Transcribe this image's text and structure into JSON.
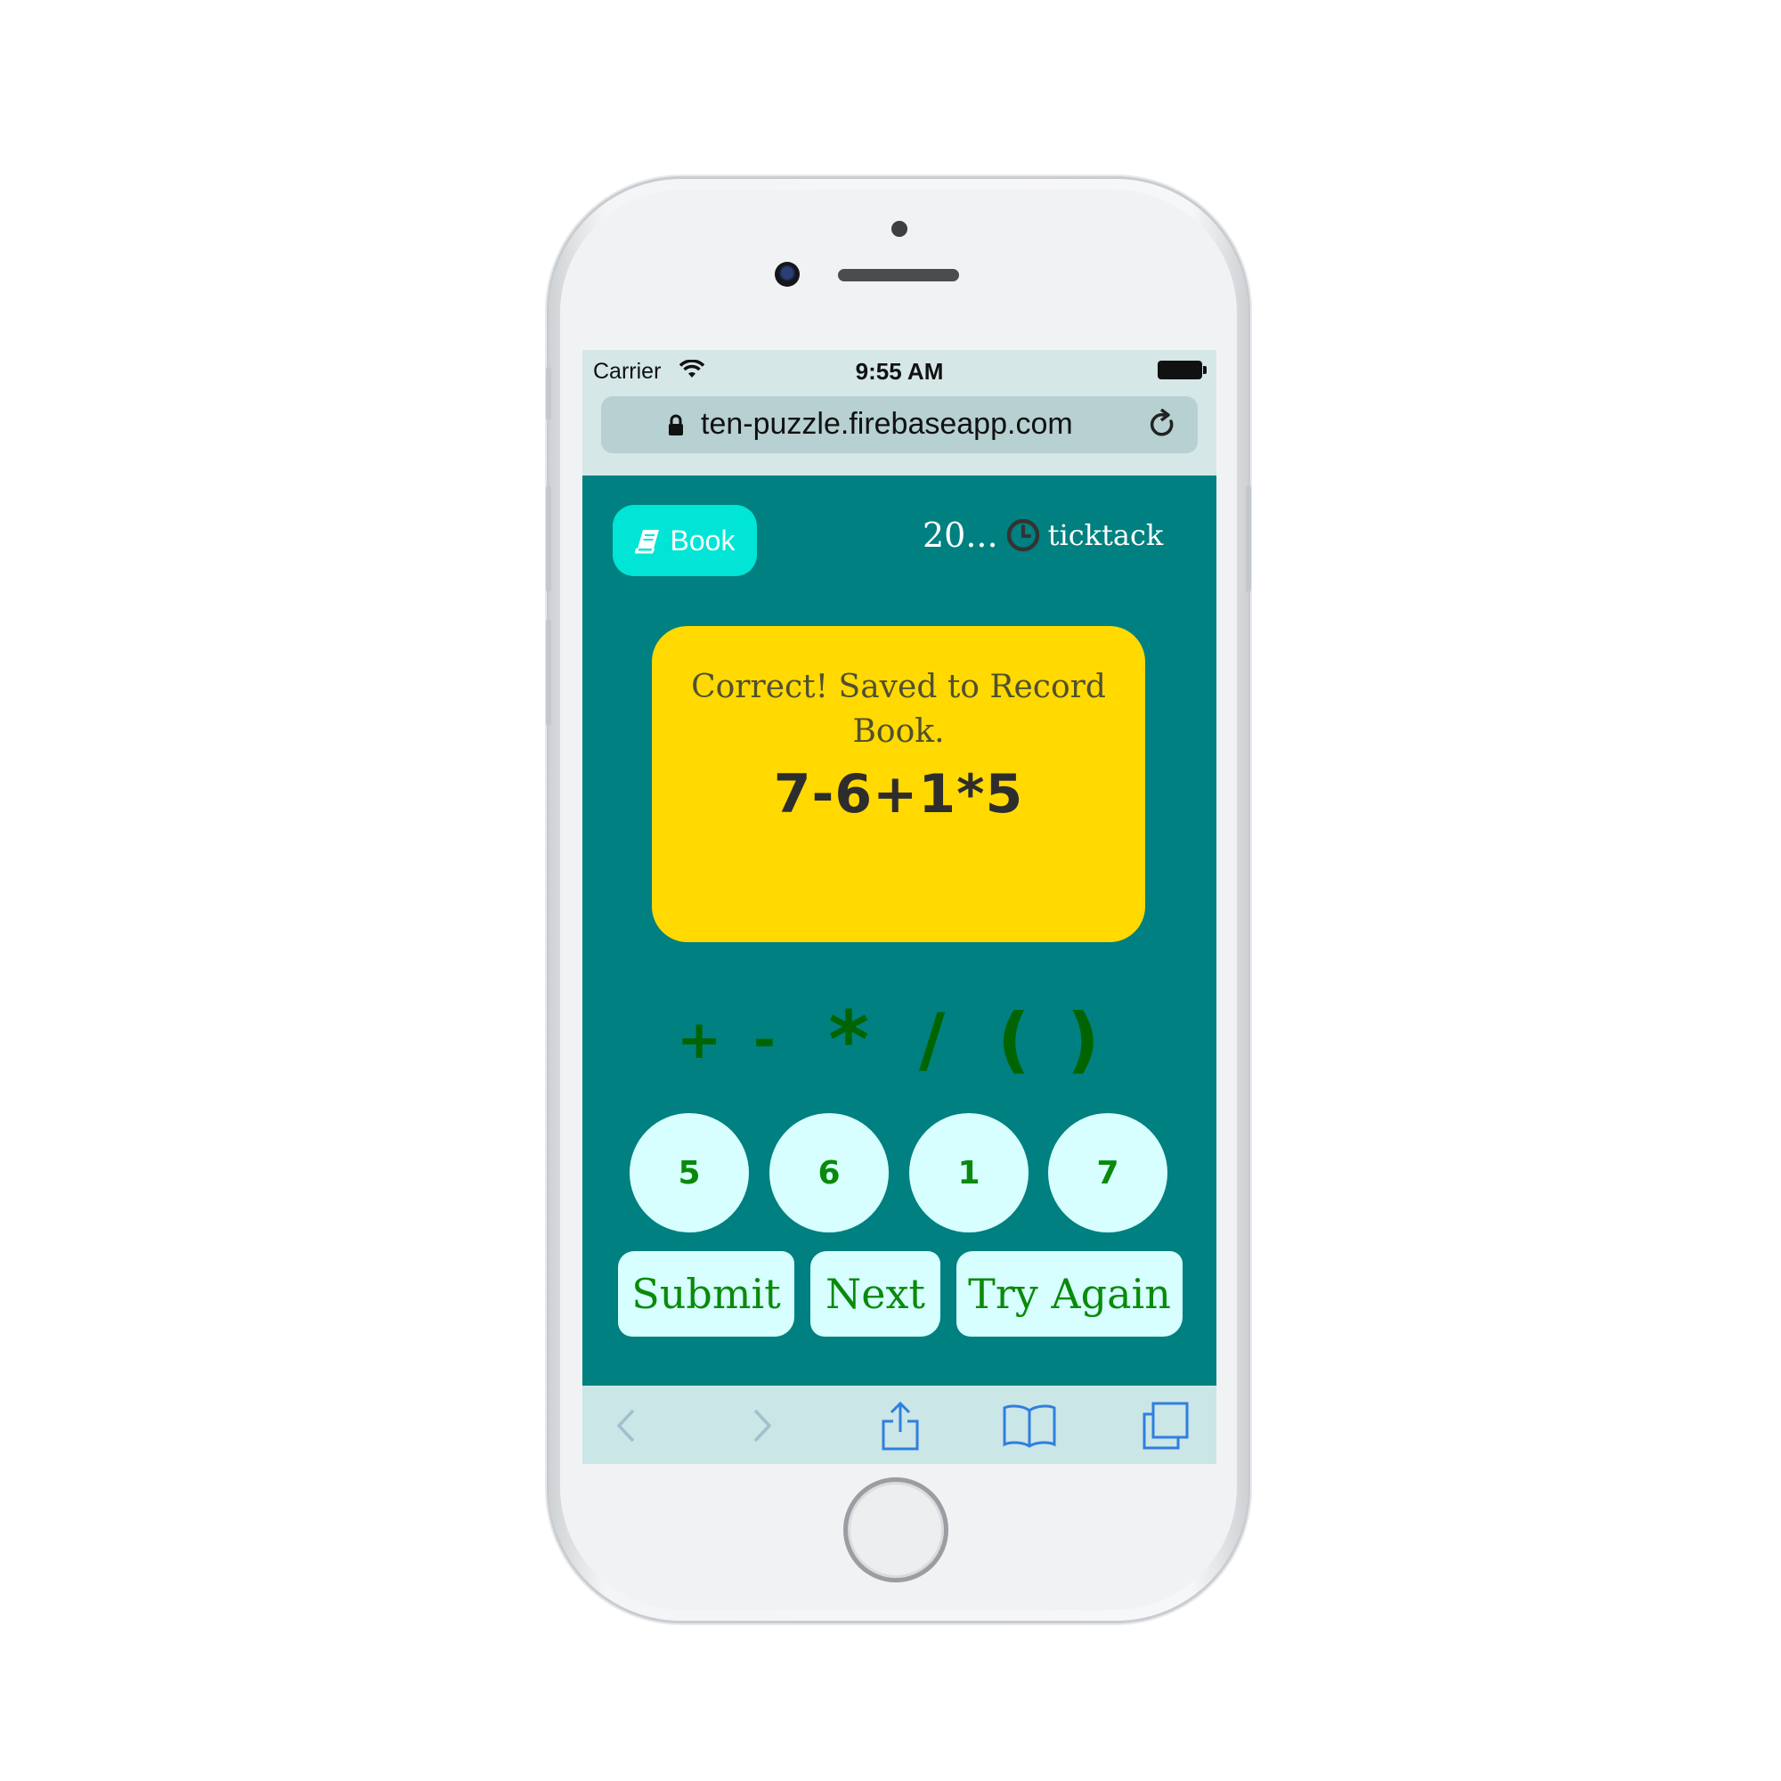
{
  "status_bar": {
    "carrier": "Carrier",
    "time": "9:55 AM"
  },
  "browser": {
    "url": "ten-puzzle.firebaseapp.com"
  },
  "header": {
    "book_label": "Book",
    "timer_count": "20...",
    "timer_label": "ticktack"
  },
  "message": {
    "text": "Correct! Saved to Record Book.",
    "expression": "7-6+1*5"
  },
  "operators": [
    "+",
    "-",
    "*",
    "/",
    "(",
    ")"
  ],
  "numbers": [
    "5",
    "6",
    "1",
    "7"
  ],
  "actions": {
    "submit": "Submit",
    "next": "Next",
    "try_again": "Try Again"
  },
  "colors": {
    "background": "#008080",
    "card": "#ffd900",
    "button": "#d7ffff",
    "book_button": "#00e5d5",
    "operator": "#006400",
    "button_text": "#0a8a0a"
  },
  "icons": [
    "wifi-icon",
    "battery-icon",
    "lock-icon",
    "reload-icon",
    "book-icon",
    "clock-icon",
    "back-icon",
    "forward-icon",
    "share-icon",
    "bookmarks-icon",
    "tabs-icon"
  ]
}
